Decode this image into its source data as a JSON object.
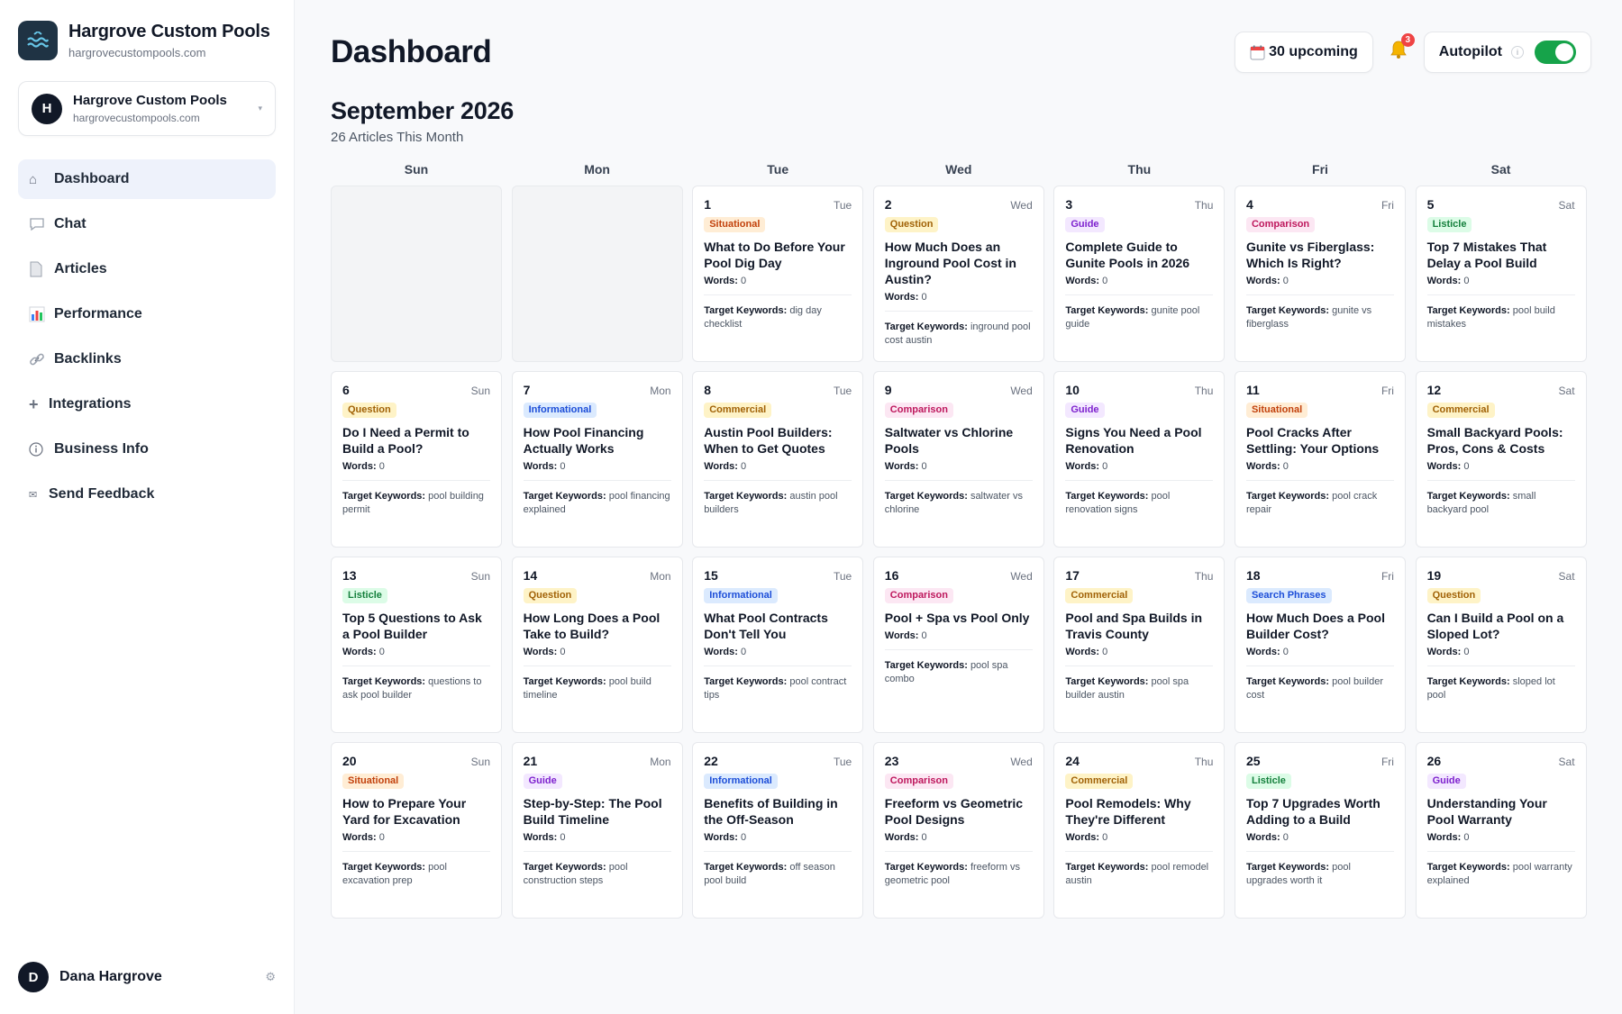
{
  "brand": {
    "name": "Hargrove Custom Pools",
    "domain": "hargrovecustompools.com"
  },
  "switcher": {
    "initial": "H",
    "name": "Hargrove Custom Pools",
    "domain": "hargrovecustompools.com"
  },
  "nav": [
    {
      "label": "Dashboard",
      "icon": "home-icon",
      "active": true
    },
    {
      "label": "Chat",
      "icon": "chat-bubble-icon"
    },
    {
      "label": "Articles",
      "icon": "document-icon"
    },
    {
      "label": "Performance",
      "icon": "bar-chart-icon"
    },
    {
      "label": "Backlinks",
      "icon": "link-icon"
    },
    {
      "label": "Integrations",
      "icon": "plus-icon"
    },
    {
      "label": "Business Info",
      "icon": "info-icon"
    },
    {
      "label": "Send Feedback",
      "icon": "mail-icon"
    }
  ],
  "user": {
    "initial": "D",
    "name": "Dana Hargrove"
  },
  "header": {
    "title": "Dashboard",
    "upcoming": "30 upcoming",
    "notifications": "3",
    "autopilot_label": "Autopilot",
    "autopilot_on": true
  },
  "calendar": {
    "month": "September 2026",
    "subtitle": "26 Articles This Month",
    "weekdays": [
      "Sun",
      "Mon",
      "Tue",
      "Wed",
      "Thu",
      "Fri",
      "Sat"
    ],
    "leading_blanks": 2,
    "words_label": "Words:",
    "keywords_label": "Target Keywords:",
    "days": [
      {
        "day": "1",
        "weekday": "Tue",
        "tag": "Situational",
        "title": "What to Do Before Your Pool Dig Day",
        "words": "0",
        "keywords": "dig day checklist"
      },
      {
        "day": "2",
        "weekday": "Wed",
        "tag": "Question",
        "title": "How Much Does an Inground Pool Cost in Austin?",
        "words": "0",
        "keywords": "inground pool cost austin"
      },
      {
        "day": "3",
        "weekday": "Thu",
        "tag": "Guide",
        "title": "Complete Guide to Gunite Pools in 2026",
        "words": "0",
        "keywords": "gunite pool guide"
      },
      {
        "day": "4",
        "weekday": "Fri",
        "tag": "Comparison",
        "title": "Gunite vs Fiberglass: Which Is Right?",
        "words": "0",
        "keywords": "gunite vs fiberglass"
      },
      {
        "day": "5",
        "weekday": "Sat",
        "tag": "Listicle",
        "title": "Top 7 Mistakes That Delay a Pool Build",
        "words": "0",
        "keywords": "pool build mistakes"
      },
      {
        "day": "6",
        "weekday": "Sun",
        "tag": "Question",
        "title": "Do I Need a Permit to Build a Pool?",
        "words": "0",
        "keywords": "pool building permit"
      },
      {
        "day": "7",
        "weekday": "Mon",
        "tag": "Informational",
        "title": "How Pool Financing Actually Works",
        "words": "0",
        "keywords": "pool financing explained"
      },
      {
        "day": "8",
        "weekday": "Tue",
        "tag": "Commercial",
        "title": "Austin Pool Builders: When to Get Quotes",
        "words": "0",
        "keywords": "austin pool builders"
      },
      {
        "day": "9",
        "weekday": "Wed",
        "tag": "Comparison",
        "title": "Saltwater vs Chlorine Pools",
        "words": "0",
        "keywords": "saltwater vs chlorine"
      },
      {
        "day": "10",
        "weekday": "Thu",
        "tag": "Guide",
        "title": "Signs You Need a Pool Renovation",
        "words": "0",
        "keywords": "pool renovation signs"
      },
      {
        "day": "11",
        "weekday": "Fri",
        "tag": "Situational",
        "title": "Pool Cracks After Settling: Your Options",
        "words": "0",
        "keywords": "pool crack repair"
      },
      {
        "day": "12",
        "weekday": "Sat",
        "tag": "Commercial",
        "title": "Small Backyard Pools: Pros, Cons & Costs",
        "words": "0",
        "keywords": "small backyard pool"
      },
      {
        "day": "13",
        "weekday": "Sun",
        "tag": "Listicle",
        "title": "Top 5 Questions to Ask a Pool Builder",
        "words": "0",
        "keywords": "questions to ask pool builder"
      },
      {
        "day": "14",
        "weekday": "Mon",
        "tag": "Question",
        "title": "How Long Does a Pool Take to Build?",
        "words": "0",
        "keywords": "pool build timeline"
      },
      {
        "day": "15",
        "weekday": "Tue",
        "tag": "Informational",
        "title": "What Pool Contracts Don't Tell You",
        "words": "0",
        "keywords": "pool contract tips"
      },
      {
        "day": "16",
        "weekday": "Wed",
        "tag": "Comparison",
        "title": "Pool + Spa vs Pool Only",
        "words": "0",
        "keywords": "pool spa combo"
      },
      {
        "day": "17",
        "weekday": "Thu",
        "tag": "Commercial",
        "title": "Pool and Spa Builds in Travis County",
        "words": "0",
        "keywords": "pool spa builder austin"
      },
      {
        "day": "18",
        "weekday": "Fri",
        "tag": "Search Phrases",
        "title": "How Much Does a Pool Builder Cost?",
        "words": "0",
        "keywords": "pool builder cost"
      },
      {
        "day": "19",
        "weekday": "Sat",
        "tag": "Question",
        "title": "Can I Build a Pool on a Sloped Lot?",
        "words": "0",
        "keywords": "sloped lot pool"
      },
      {
        "day": "20",
        "weekday": "Sun",
        "tag": "Situational",
        "title": "How to Prepare Your Yard for Excavation",
        "words": "0",
        "keywords": "pool excavation prep"
      },
      {
        "day": "21",
        "weekday": "Mon",
        "tag": "Guide",
        "title": "Step-by-Step: The Pool Build Timeline",
        "words": "0",
        "keywords": "pool construction steps"
      },
      {
        "day": "22",
        "weekday": "Tue",
        "tag": "Informational",
        "title": "Benefits of Building in the Off-Season",
        "words": "0",
        "keywords": "off season pool build"
      },
      {
        "day": "23",
        "weekday": "Wed",
        "tag": "Comparison",
        "title": "Freeform vs Geometric Pool Designs",
        "words": "0",
        "keywords": "freeform vs geometric pool"
      },
      {
        "day": "24",
        "weekday": "Thu",
        "tag": "Commercial",
        "title": "Pool Remodels: Why They're Different",
        "words": "0",
        "keywords": "pool remodel austin"
      },
      {
        "day": "25",
        "weekday": "Fri",
        "tag": "Listicle",
        "title": "Top 7 Upgrades Worth Adding to a Build",
        "words": "0",
        "keywords": "pool upgrades worth it"
      },
      {
        "day": "26",
        "weekday": "Sat",
        "tag": "Guide",
        "title": "Understanding Your Pool Warranty",
        "words": "0",
        "keywords": "pool warranty explained"
      }
    ]
  },
  "colors": {
    "accent": "#1f3344",
    "toggle_on": "#16a34a",
    "badge": "#ef4444",
    "active_nav": "#eef2fb"
  }
}
